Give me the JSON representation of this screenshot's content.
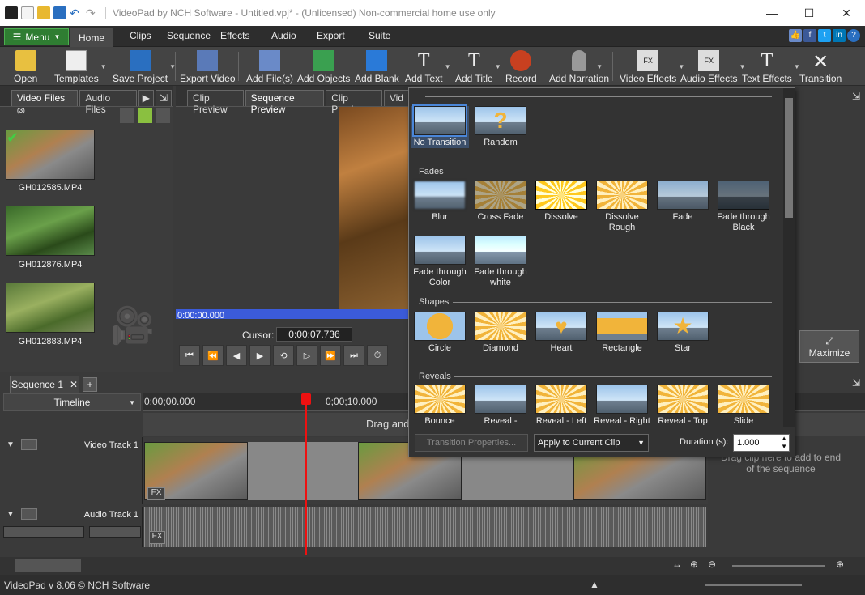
{
  "titlebar": {
    "title": "VideoPad by NCH Software - Untitled.vpj* - (Unlicensed) Non-commercial home use only"
  },
  "ribbon_tabs": {
    "menu": "Menu",
    "home": "Home",
    "clips": "Clips",
    "sequence": "Sequence",
    "effects": "Effects",
    "audio": "Audio",
    "export": "Export",
    "suite": "Suite"
  },
  "toolbar": {
    "open": "Open",
    "templates": "Templates",
    "save_project": "Save Project",
    "export_video": "Export Video",
    "add_files": "Add File(s)",
    "add_objects": "Add Objects",
    "add_blank": "Add Blank",
    "add_text": "Add Text",
    "add_title": "Add Title",
    "record": "Record",
    "add_narration": "Add Narration",
    "video_effects": "Video Effects",
    "audio_effects": "Audio Effects",
    "text_effects": "Text Effects",
    "transition": "Transition"
  },
  "left_panel": {
    "tab_video": "Video Files",
    "tab_video_count": "(3)",
    "tab_audio": "Audio Files",
    "files": [
      {
        "name": "GH012585.MP4"
      },
      {
        "name": "GH012876.MP4"
      },
      {
        "name": "GH012883.MP4"
      }
    ]
  },
  "preview": {
    "tab_clip": "Clip Preview",
    "tab_sequence": "Sequence Preview",
    "tab_clip2": "Clip Preview",
    "tab_vi": "Vid",
    "timecode": "0:00:00.000",
    "cursor_label": "Cursor:",
    "cursor_value": "0:00:07.736"
  },
  "right_panel": {
    "maximize": "Maximize"
  },
  "transitions": {
    "top": [
      {
        "label": "No Transition"
      },
      {
        "label": "Random"
      }
    ],
    "fades_title": "Fades",
    "fades": [
      {
        "label": "Blur"
      },
      {
        "label": "Cross Fade"
      },
      {
        "label": "Dissolve"
      },
      {
        "label": "Dissolve Rough"
      },
      {
        "label": "Fade"
      },
      {
        "label": "Fade through Black"
      },
      {
        "label": "Fade through Color"
      },
      {
        "label": "Fade through white"
      }
    ],
    "shapes_title": "Shapes",
    "shapes": [
      {
        "label": "Circle"
      },
      {
        "label": "Diamond"
      },
      {
        "label": "Heart"
      },
      {
        "label": "Rectangle"
      },
      {
        "label": "Star"
      }
    ],
    "reveals_title": "Reveals",
    "reveals": [
      {
        "label": "Bounce"
      },
      {
        "label": "Reveal -"
      },
      {
        "label": "Reveal - Left"
      },
      {
        "label": "Reveal - Right"
      },
      {
        "label": "Reveal - Top"
      },
      {
        "label": "Slide"
      }
    ],
    "footer": {
      "properties": "Transition Properties...",
      "apply": "Apply to Current Clip",
      "duration_label": "Duration (s):",
      "duration_value": "1.000"
    }
  },
  "timeline": {
    "seq_tab": "Sequence 1",
    "header": "Timeline",
    "ruler_start": "0;00;00.000",
    "ruler_mid": "0;00;10.000",
    "drag_hint": "Drag and",
    "video_track": "Video Track 1",
    "audio_track": "Audio Track 1",
    "drop_hint": "Drag clip here to add to end of the sequence"
  },
  "status": {
    "text": "VideoPad v 8.06 © NCH Software"
  }
}
